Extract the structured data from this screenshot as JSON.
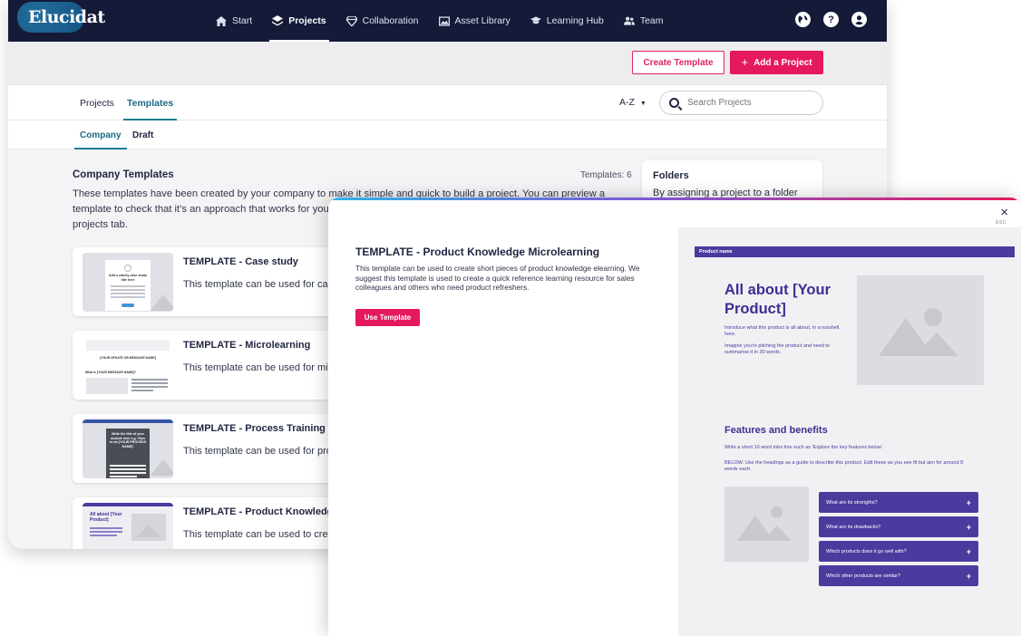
{
  "app": {
    "logo": "Elucidat",
    "nav": [
      {
        "label": "Start",
        "icon": "home-icon"
      },
      {
        "label": "Projects",
        "icon": "layers-icon",
        "active": true
      },
      {
        "label": "Collaboration",
        "icon": "diamond-icon"
      },
      {
        "label": "Asset Library",
        "icon": "image-icon"
      },
      {
        "label": "Learning Hub",
        "icon": "graduation-cap-icon"
      },
      {
        "label": "Team",
        "icon": "users-icon"
      }
    ],
    "top_right_icons": [
      "globe-icon",
      "help-icon",
      "user-icon"
    ],
    "actions": {
      "create_template": "Create Template",
      "add_project": "Add a Project"
    },
    "tabs": [
      {
        "label": "Projects"
      },
      {
        "label": "Templates",
        "active": true
      }
    ],
    "sort": "A-Z",
    "search": {
      "placeholder": "Search Projects"
    },
    "subtabs": [
      {
        "label": "Company",
        "active": true
      },
      {
        "label": "Draft"
      }
    ],
    "section": {
      "title": "Company Templates",
      "count": "Templates: 6",
      "description": "These templates have been created by your company to make it simple and quick to build a project. You can preview a template to check that it’s an approach that works for you, then use it to create a new project which will appear in your projects tab."
    },
    "folders": {
      "title": "Folders",
      "text": "By assigning a project to a folder"
    },
    "cards": [
      {
        "title": "TEMPLATE - Case study",
        "desc": "This template can be used for case studies"
      },
      {
        "title": "TEMPLATE - Microlearning",
        "desc": "This template can be used for microlearning"
      },
      {
        "title": "TEMPLATE - Process Training",
        "desc": "This template can be used for process training"
      },
      {
        "title": "TEMPLATE - Product Knowledge Microlearning",
        "desc": "This template can be used to create short pieces"
      }
    ],
    "thumb_texts": {
      "t1": "Add a catchy case study title here",
      "t2": "[YOUR UPDATE OR MESSAGE NAME]",
      "t2b": "What is [YOUR MESSAGE NAME]?",
      "t3": "Write the title of your module here e.g. 'How to do [YOUR PROCESS NAME]'",
      "t4": "All about [Your Product]"
    }
  },
  "modal": {
    "close": "×",
    "esc": "ESC",
    "title": "TEMPLATE - Product Knowledge Microlearning",
    "description": "This template can be used to create short pieces of product knowledge elearning. We suggest this template is used to create a quick reference learning resource for sales colleagues and others who need product refreshers.",
    "use_button": "Use Template",
    "preview": {
      "bar": "Product name",
      "heading": "All about [Your Product]",
      "intro1": "Introduce what this product is all about, in a nutshell, here.",
      "intro2": "Imagine you're pitching the product and need to summarise it in 30 words.",
      "features_title": "Features and benefits",
      "features_intro": "Write a short 10 word intro line such as 'Explore the key features below'.",
      "features_note": "BELOW: Use the headings as a guide to describe this product. Edit these as you see fit but aim for around 8 words each.",
      "accordion": [
        "What are its strengths?",
        "What are its drawbacks?",
        "Which products does it go well with?",
        "Which other products are similar?"
      ]
    }
  },
  "colors": {
    "nav_bg": "#141a38",
    "accent_pink": "#e5195d",
    "accent_teal": "#1a7d8f",
    "preview_purple": "#4b3b9e"
  }
}
